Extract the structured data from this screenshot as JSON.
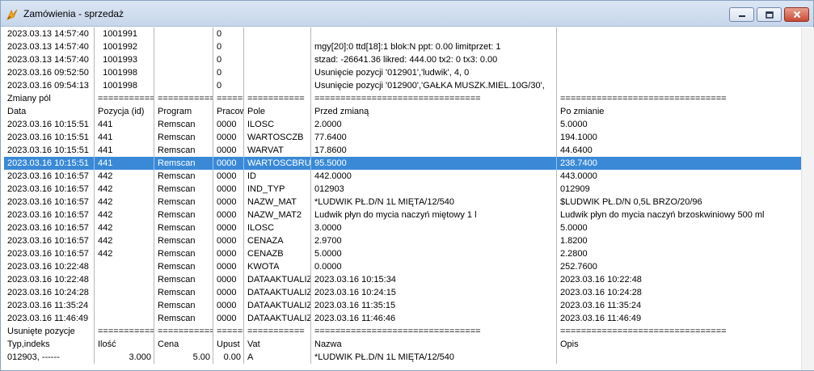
{
  "window": {
    "title": "Zamówienia - sprzedaż"
  },
  "rows": [
    {
      "cells": [
        "2023.03.13 14:57:40",
        "1001991",
        "",
        "0",
        "",
        "",
        ""
      ]
    },
    {
      "cells": [
        "2023.03.13 14:57:40",
        "1001992",
        "",
        "0",
        "",
        "mgy[20]:0 ttd[18]:1 blok:N ppt:        0.00 limitprzet:          1",
        ""
      ]
    },
    {
      "cells": [
        "2023.03.13 14:57:40",
        "1001993",
        "",
        "0",
        "",
        "stzad:   -26641.36 likred:       444.00 tx2:          0 tx3:          0.00",
        ""
      ]
    },
    {
      "cells": [
        "2023.03.16 09:52:50",
        "1001998",
        "",
        "0",
        "",
        "Usunięcie pozycji '012901','ludwik',          4,          0",
        ""
      ]
    },
    {
      "cells": [
        "2023.03.16 09:54:13",
        "1001998",
        "",
        "0",
        "",
        "Usunięcie pozycji '012900','GAŁKA MUSZK.MIEL.10G/30',",
        ""
      ]
    },
    {
      "cells": [
        "Zmiany pól",
        "===========",
        "===============",
        "========",
        "===========",
        "================================",
        "================================"
      ]
    },
    {
      "cells": [
        "Data",
        "Pozycja (id)",
        "Program",
        "Pracow",
        "Pole",
        "Przed zmianą",
        "Po zmianie"
      ]
    },
    {
      "cells": [
        "2023.03.16 10:15:51",
        "441",
        "Remscan",
        "0000",
        "ILOSC",
        "2.0000",
        "5.0000"
      ]
    },
    {
      "cells": [
        "2023.03.16 10:15:51",
        "441",
        "Remscan",
        "0000",
        "WARTOSCZB",
        "77.6400",
        "194.1000"
      ]
    },
    {
      "cells": [
        "2023.03.16 10:15:51",
        "441",
        "Remscan",
        "0000",
        "WARVAT",
        "17.8600",
        "44.6400"
      ]
    },
    {
      "cells": [
        "2023.03.16 10:15:51",
        "441",
        "Remscan",
        "0000",
        "WARTOSCBRUT",
        "95.5000",
        "238.7400"
      ],
      "selected": true
    },
    {
      "cells": [
        "2023.03.16 10:16:57",
        "442",
        "Remscan",
        "0000",
        "ID",
        "442.0000",
        "443.0000"
      ]
    },
    {
      "cells": [
        "2023.03.16 10:16:57",
        "442",
        "Remscan",
        "0000",
        "IND_TYP",
        "012903",
        "012909"
      ]
    },
    {
      "cells": [
        "2023.03.16 10:16:57",
        "442",
        "Remscan",
        "0000",
        "NAZW_MAT",
        "*LUDWIK PŁ.D/N 1L MIĘTA/12/540",
        "$LUDWIK PŁ.D/N 0,5L BRZO/20/96"
      ]
    },
    {
      "cells": [
        "2023.03.16 10:16:57",
        "442",
        "Remscan",
        "0000",
        "NAZW_MAT2",
        "Ludwik płyn do mycia naczyń miętowy 1 l",
        "Ludwik płyn do mycia naczyń brzoskwiniowy 500 ml"
      ]
    },
    {
      "cells": [
        "2023.03.16 10:16:57",
        "442",
        "Remscan",
        "0000",
        "ILOSC",
        "3.0000",
        "5.0000"
      ]
    },
    {
      "cells": [
        "2023.03.16 10:16:57",
        "442",
        "Remscan",
        "0000",
        "CENAZA",
        "2.9700",
        "1.8200"
      ]
    },
    {
      "cells": [
        "2023.03.16 10:16:57",
        "442",
        "Remscan",
        "0000",
        "CENAZB",
        "5.0000",
        "2.2800"
      ]
    },
    {
      "cells": [
        "2023.03.16 10:22:48",
        "",
        "Remscan",
        "0000",
        "KWOTA",
        "0.0000",
        "252.7600"
      ]
    },
    {
      "cells": [
        "2023.03.16 10:22:48",
        "",
        "Remscan",
        "0000",
        "DATAAKTUALIZ",
        "2023.03.16 10:15:34",
        "2023.03.16 10:22:48"
      ]
    },
    {
      "cells": [
        "2023.03.16 10:24:28",
        "",
        "Remscan",
        "0000",
        "DATAAKTUALIZ",
        "2023.03.16 10:24:15",
        "2023.03.16 10:24:28"
      ]
    },
    {
      "cells": [
        "2023.03.16 11:35:24",
        "",
        "Remscan",
        "0000",
        "DATAAKTUALIZ",
        "2023.03.16 11:35:15",
        "2023.03.16 11:35:24"
      ]
    },
    {
      "cells": [
        "2023.03.16 11:46:49",
        "",
        "Remscan",
        "0000",
        "DATAAKTUALIZ",
        "2023.03.16 11:46:46",
        "2023.03.16 11:46:49"
      ]
    },
    {
      "cells": [
        "Usunięte pozycje",
        "===========",
        "===============",
        "========",
        "===========",
        "================================",
        "================================"
      ]
    },
    {
      "cells": [
        "Typ,indeks",
        "Ilość",
        "Cena",
        "Upust",
        "Vat",
        "Nazwa",
        "Opis"
      ]
    },
    {
      "cells": [
        "012903, ------",
        "3.000",
        "5.00",
        "0.00",
        "A",
        "*LUDWIK PŁ.D/N 1L MIĘTA/12/540",
        ""
      ],
      "align_right": [
        1,
        2,
        3
      ]
    }
  ]
}
